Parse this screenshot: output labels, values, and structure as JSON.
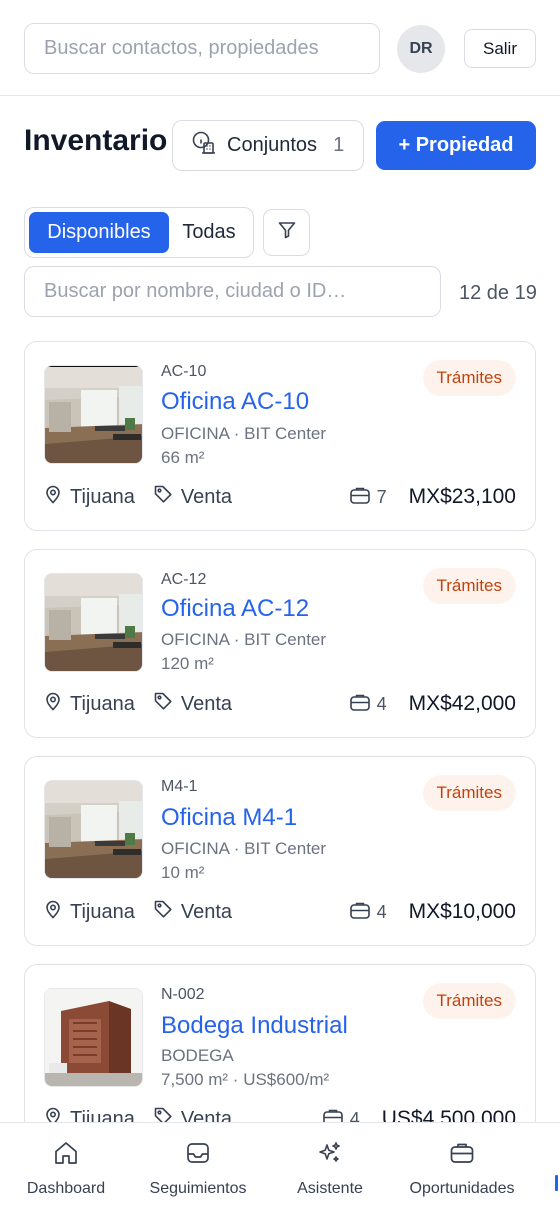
{
  "header": {
    "search_placeholder": "Buscar contactos, propiedades",
    "avatar_initials": "DR",
    "logout_label": "Salir"
  },
  "page": {
    "title": "Inventario",
    "sets_label": "Conjuntos",
    "sets_count": "1",
    "add_property_label": "+ Propiedad"
  },
  "filters": {
    "available_label": "Disponibles",
    "all_label": "Todas",
    "search_placeholder": "Buscar por nombre, ciudad o ID…",
    "result_count": "12 de 19"
  },
  "properties": [
    {
      "code": "AC-10",
      "name": "Oficina AC-10",
      "type": "OFICINA",
      "project": "BIT Center",
      "area": "66 m²",
      "status": "Trámites",
      "city": "Tijuana",
      "operation": "Venta",
      "opportunities": "7",
      "price": "MX$23,100"
    },
    {
      "code": "AC-12",
      "name": "Oficina AC-12",
      "type": "OFICINA",
      "project": "BIT Center",
      "area": "120 m²",
      "status": "Trámites",
      "city": "Tijuana",
      "operation": "Venta",
      "opportunities": "4",
      "price": "MX$42,000"
    },
    {
      "code": "M4-1",
      "name": "Oficina M4-1",
      "type": "OFICINA",
      "project": "BIT Center",
      "area": "10 m²",
      "status": "Trámites",
      "city": "Tijuana",
      "operation": "Venta",
      "opportunities": "4",
      "price": "MX$10,000"
    },
    {
      "code": "N-002",
      "name": "Bodega Industrial",
      "type": "BODEGA",
      "area_line": "7,500 m²  ·  US$600/m²",
      "status": "Trámites",
      "city": "Tijuana",
      "operation": "Venta",
      "opportunities": "4",
      "price": "US$4,500,000"
    }
  ],
  "nav": {
    "items": [
      {
        "label": "Dashboard",
        "icon": "home-icon"
      },
      {
        "label": "Seguimientos",
        "icon": "inbox-icon"
      },
      {
        "label": "Asistente",
        "icon": "sparkles-icon"
      },
      {
        "label": "Oportunidades",
        "icon": "briefcase-icon"
      }
    ]
  },
  "colors": {
    "accent": "#2563eb",
    "badge_bg": "#fef3ec",
    "badge_text": "#c2410c"
  }
}
